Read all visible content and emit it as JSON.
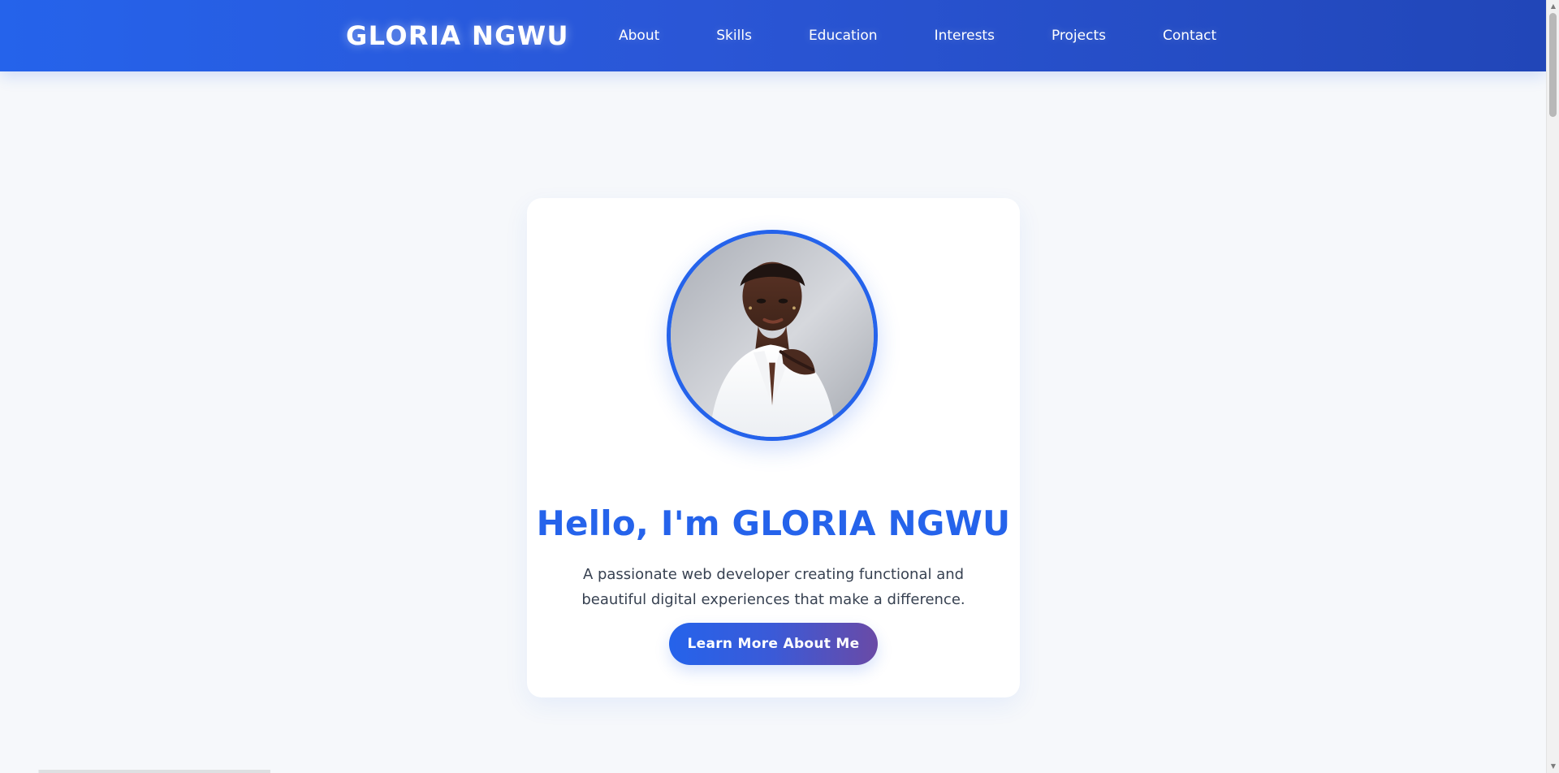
{
  "nav": {
    "brand": "GLORIA NGWU",
    "links": [
      {
        "label": "About"
      },
      {
        "label": "Skills"
      },
      {
        "label": "Education"
      },
      {
        "label": "Interests"
      },
      {
        "label": "Projects"
      },
      {
        "label": "Contact"
      }
    ]
  },
  "hero": {
    "title": "Hello, I'm GLORIA NGWU",
    "subtitle": "A passionate web developer creating functional and beautiful digital experiences that make a difference.",
    "button_label": "Learn More About Me",
    "avatar_icon": "portrait-photo"
  },
  "colors": {
    "primary": "#2563eb",
    "nav_background": "#2563eb",
    "page_background": "#f6f8fb",
    "card_background": "#ffffff",
    "button_gradient_end": "#6a4aa6"
  },
  "scrollbar": {
    "up_icon": "scroll-up-icon",
    "down_icon": "scroll-down-icon"
  }
}
